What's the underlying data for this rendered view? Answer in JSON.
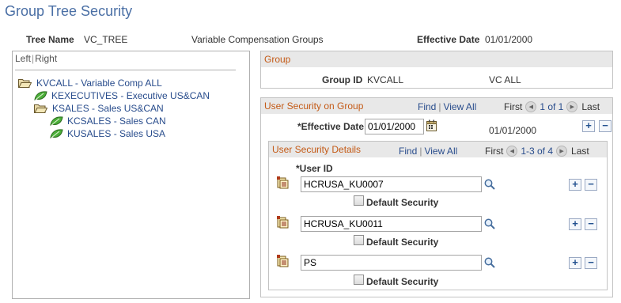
{
  "page": {
    "title": "Group Tree Security"
  },
  "header": {
    "tree_name_label": "Tree Name",
    "tree_name_value": "VC_TREE",
    "tree_description": "Variable Compensation Groups",
    "effective_date_label": "Effective Date",
    "effective_date_value": "01/01/2000"
  },
  "left_panel": {
    "left_link": "Left",
    "separator": "|",
    "right_link": "Right",
    "tree_nodes": [
      {
        "label": "KVCALL - Variable Comp ALL",
        "icon": "open-folder-icon"
      },
      {
        "label": "KEXECUTIVES - Executive US&CAN",
        "icon": "leaf-icon"
      },
      {
        "label": "KSALES - Sales US&CAN",
        "icon": "open-folder-icon"
      },
      {
        "label": "KCSALES - Sales CAN",
        "icon": "leaf-icon"
      },
      {
        "label": "KUSALES - Sales USA",
        "icon": "leaf-icon"
      }
    ]
  },
  "group": {
    "section_title": "Group",
    "group_id_label": "Group ID",
    "group_id_value": "KVCALL",
    "group_description": "VC ALL"
  },
  "user_security_on_group": {
    "section_title": "User Security on Group",
    "find_link": "Find",
    "pipe": "|",
    "view_all_link": "View All",
    "first_label": "First",
    "pager_text": "1 of 1",
    "last_label": "Last",
    "effective_date_label": "*Effective Date",
    "effective_date_value": "01/01/2000",
    "effective_date_display": "01/01/2000",
    "add_button": "+",
    "remove_button": "−"
  },
  "user_security_details": {
    "section_title": "User Security Details",
    "find_link": "Find",
    "pipe": "|",
    "view_all_link": "View All",
    "first_label": "First",
    "pager_text": "1-3 of 4",
    "last_label": "Last",
    "user_id_label": "*User ID",
    "default_security_label": "Default Security",
    "add_button": "+",
    "remove_button": "−",
    "rows": [
      {
        "user_id": "HCRUSA_KU0007",
        "default_security": false
      },
      {
        "user_id": "HCRUSA_KU0011",
        "default_security": false
      },
      {
        "user_id": "PS",
        "default_security": false
      }
    ]
  },
  "colors": {
    "title": "#4a6fa5",
    "link": "#284c8c",
    "section_header_text": "#c45a16",
    "section_header_bg": "#e8e8e8",
    "leaf_green": "#3a9a2a",
    "folder_tan": "#d9c48a"
  }
}
